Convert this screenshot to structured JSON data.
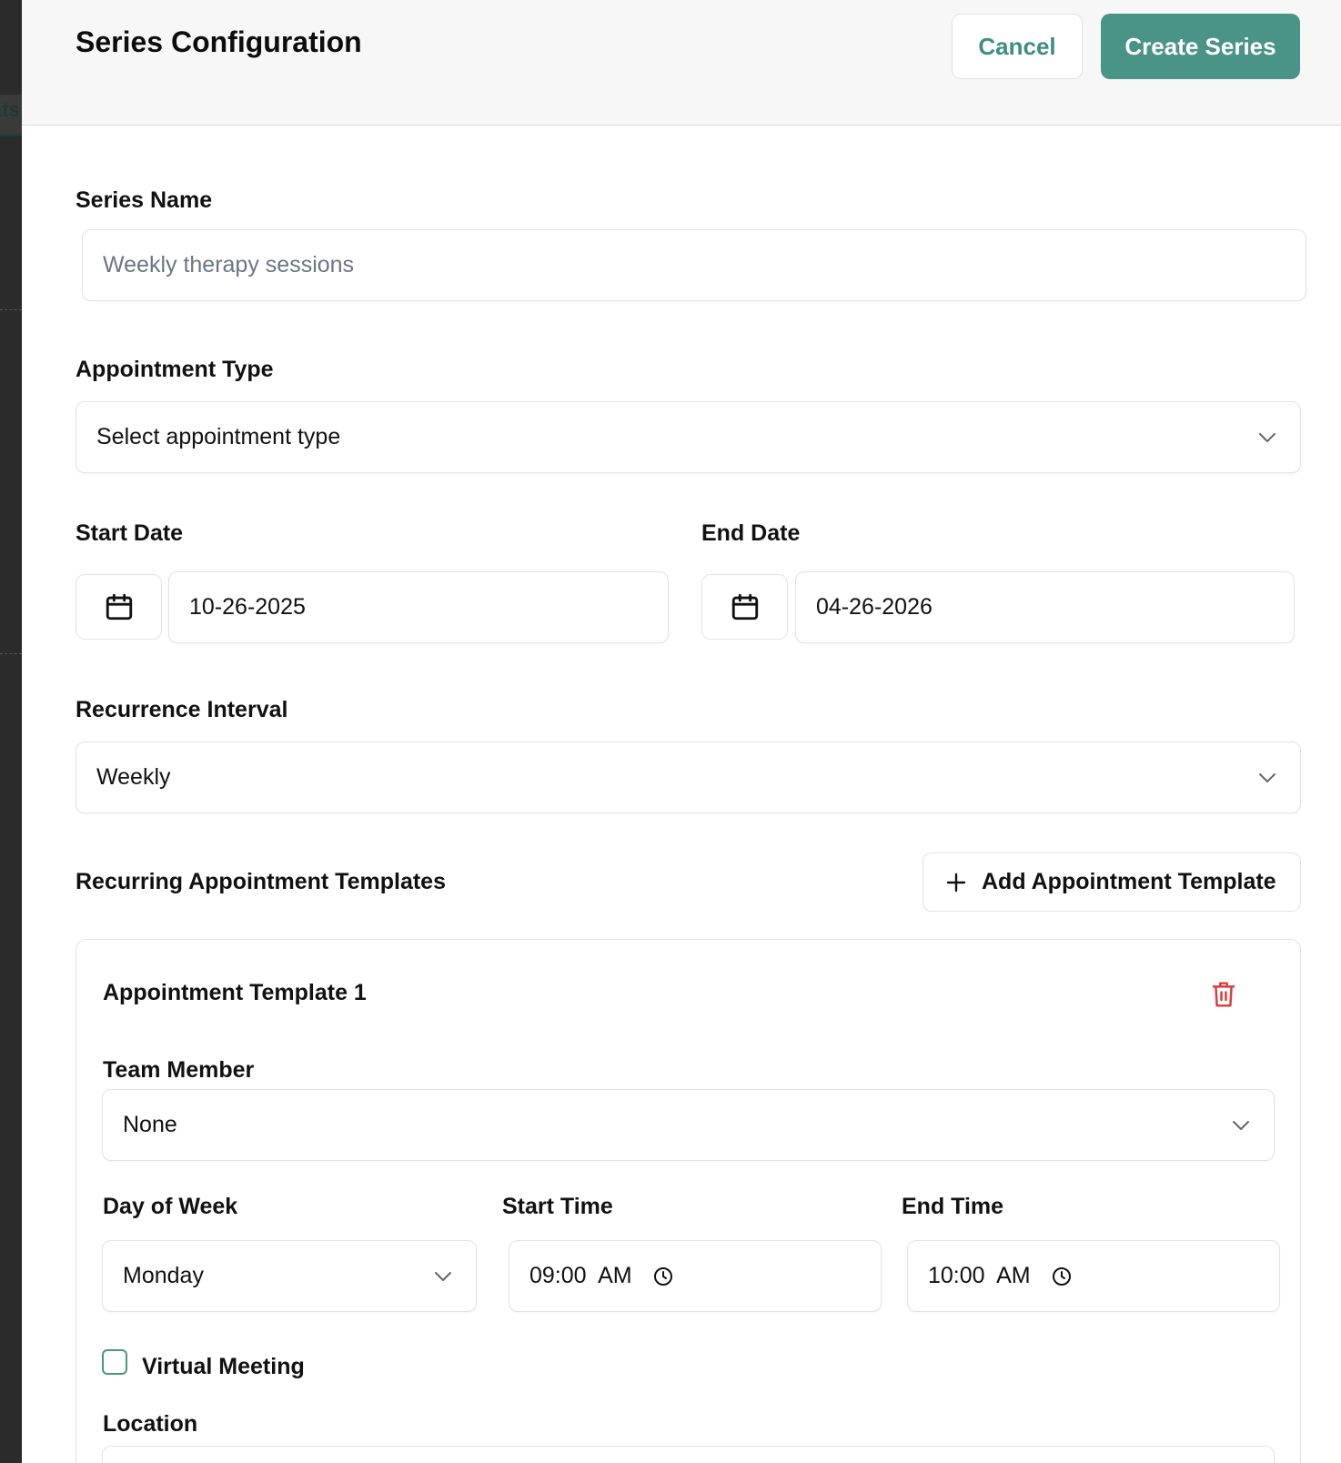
{
  "header": {
    "title": "Series Configuration",
    "cancel_label": "Cancel",
    "create_label": "Create Series"
  },
  "backdrop": {
    "tab_fragment": "ats"
  },
  "form": {
    "series_name": {
      "label": "Series Name",
      "placeholder": "Weekly therapy sessions",
      "value": ""
    },
    "appointment_type": {
      "label": "Appointment Type",
      "value": "Select appointment type"
    },
    "start_date": {
      "label": "Start Date",
      "value": "10-26-2025"
    },
    "end_date": {
      "label": "End Date",
      "value": "04-26-2026"
    },
    "recurrence": {
      "label": "Recurrence Interval",
      "value": "Weekly"
    },
    "templates_heading": "Recurring Appointment Templates",
    "add_template_label": "Add Appointment Template"
  },
  "template": {
    "title": "Appointment Template 1",
    "team_member": {
      "label": "Team Member",
      "value": "None"
    },
    "day_of_week": {
      "label": "Day of Week",
      "value": "Monday"
    },
    "start_time": {
      "label": "Start Time",
      "value": "09:00  AM"
    },
    "end_time": {
      "label": "End Time",
      "value": "10:00  AM"
    },
    "virtual_meeting": {
      "label": "Virtual Meeting",
      "checked": false
    },
    "location": {
      "label": "Location"
    }
  },
  "colors": {
    "accent": "#4a9487",
    "danger": "#dc3b3b"
  }
}
